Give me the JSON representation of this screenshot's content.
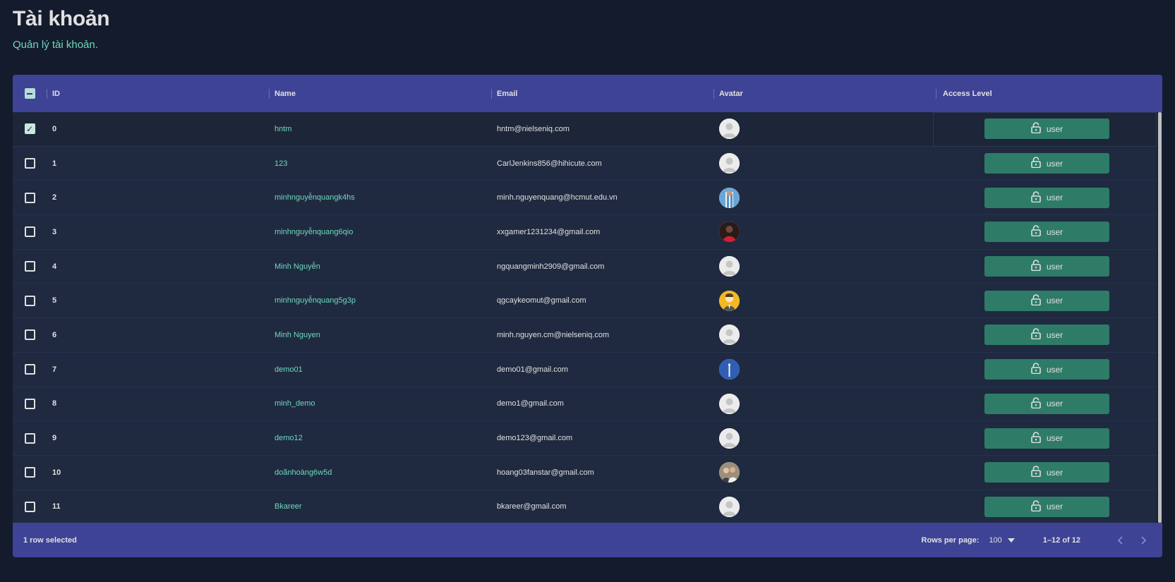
{
  "header": {
    "title": "Tài khoản",
    "subtitle": "Quản lý tài khoản."
  },
  "grid": {
    "columns": {
      "id": "ID",
      "name": "Name",
      "email": "Email",
      "avatar": "Avatar",
      "access": "Access Level"
    },
    "rows": [
      {
        "id": "0",
        "name": "hntm",
        "email": "hntm@nielseniq.com",
        "avatar": "default-avatar",
        "access": "user",
        "selected": true
      },
      {
        "id": "1",
        "name": "123",
        "email": "CarlJenkins856@hihicute.com",
        "avatar": "default-avatar",
        "access": "user",
        "selected": false
      },
      {
        "id": "2",
        "name": "minhnguyễnquangk4hs",
        "email": "minh.nguyenquang@hcmut.edu.vn",
        "avatar": "photo-avatar-blue",
        "access": "user",
        "selected": false
      },
      {
        "id": "3",
        "name": "minhnguyễnquang6qio",
        "email": "xxgamer1231234@gmail.com",
        "avatar": "photo-avatar-red",
        "access": "user",
        "selected": false
      },
      {
        "id": "4",
        "name": "Minh Nguyễn",
        "email": "ngquangminh2909@gmail.com",
        "avatar": "default-avatar",
        "access": "user",
        "selected": false
      },
      {
        "id": "5",
        "name": "minhnguyễnquang5g3p",
        "email": "qgcaykeomut@gmail.com",
        "avatar": "photo-avatar-yellow",
        "access": "user",
        "selected": false
      },
      {
        "id": "6",
        "name": "Minh Nguyen",
        "email": "minh.nguyen.cm@nielseniq.com",
        "avatar": "default-avatar",
        "access": "user",
        "selected": false
      },
      {
        "id": "7",
        "name": "demo01",
        "email": "demo01@gmail.com",
        "avatar": "photo-avatar-bluedot",
        "access": "user",
        "selected": false
      },
      {
        "id": "8",
        "name": "minh_demo",
        "email": "demo1@gmail.com",
        "avatar": "default-avatar",
        "access": "user",
        "selected": false
      },
      {
        "id": "9",
        "name": "demo12",
        "email": "demo123@gmail.com",
        "avatar": "default-avatar",
        "access": "user",
        "selected": false
      },
      {
        "id": "10",
        "name": "doãnhoàng6w5d",
        "email": "hoang03fanstar@gmail.com",
        "avatar": "photo-avatar-people",
        "access": "user",
        "selected": false
      },
      {
        "id": "11",
        "name": "Bkareer",
        "email": "bkareer@gmail.com",
        "avatar": "default-avatar",
        "access": "user",
        "selected": false
      }
    ]
  },
  "footer": {
    "selected_text": "1 row selected",
    "rows_per_page_label": "Rows per page:",
    "rows_per_page_value": "100",
    "range_text": "1–12 of 12"
  },
  "colors": {
    "background": "#141b2d",
    "panel": "#1f2a40",
    "header": "#3e4396",
    "accent": "#70d8bd",
    "button": "#2e7c67"
  }
}
